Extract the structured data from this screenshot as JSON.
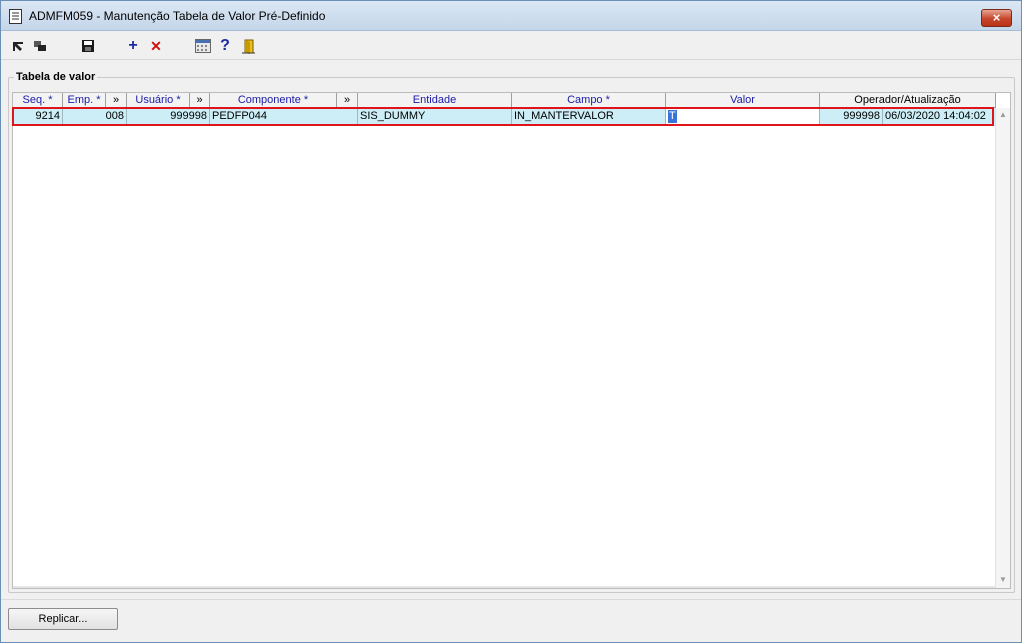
{
  "window": {
    "title": "ADMFM059 - Manutenção Tabela de Valor Pré-Definido",
    "close_label": "×"
  },
  "toolbar": {
    "icons": [
      "nav-first-icon",
      "nav-back-icon",
      "save-icon",
      "add-icon",
      "delete-icon",
      "calculator-icon",
      "help-icon",
      "exit-door-icon"
    ],
    "add_glyph": "+",
    "delete_glyph": "✕",
    "help_glyph": "?"
  },
  "group": {
    "label": "Tabela de valor"
  },
  "grid": {
    "columns": {
      "seq": "Seq. *",
      "emp": "Emp. *",
      "lookup1": "»",
      "usuario": "Usuário *",
      "lookup2": "»",
      "componente": "Componente *",
      "lookup3": "»",
      "entidade": "Entidade",
      "campo": "Campo *",
      "valor": "Valor",
      "operador": "Operador/Atualização"
    },
    "rows": [
      {
        "seq": "9214",
        "emp": "008",
        "usuario": "999998",
        "componente": "PEDFP044",
        "entidade": "SIS_DUMMY",
        "campo": "IN_MANTERVALOR",
        "valor": "T",
        "operador": "999998",
        "atualizacao": "06/03/2020 14:04:02"
      }
    ],
    "scroll_up": "▲",
    "scroll_down": "▼"
  },
  "buttons": {
    "replicar": "Replicar..."
  },
  "colors": {
    "header_text": "#1b1ba8",
    "row_bg": "#cdeef6",
    "selection_outline": "#e0141b"
  }
}
